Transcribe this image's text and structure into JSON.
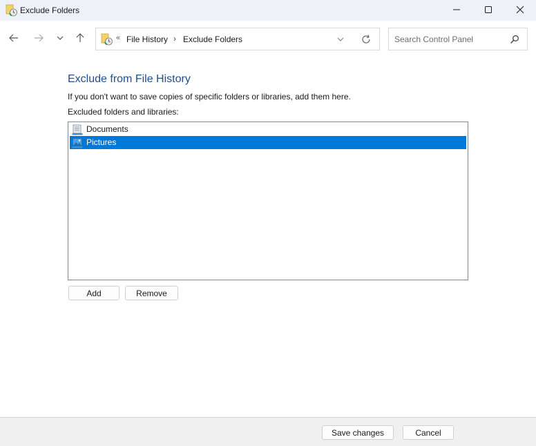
{
  "window": {
    "title": "Exclude Folders",
    "app_icon": "file-history-icon",
    "controls": {
      "minimize": "minimize-icon",
      "maximize": "maximize-icon",
      "close": "close-icon"
    }
  },
  "navigation": {
    "back_icon": "arrow-left-icon",
    "forward_icon": "arrow-right-icon",
    "recent_icon": "chevron-down-icon",
    "up_icon": "arrow-up-icon",
    "address": {
      "overflow_glyph": "«",
      "breadcrumbs": [
        "File History",
        "Exclude Folders"
      ],
      "separator": "›"
    },
    "search": {
      "placeholder": "Search Control Panel",
      "value": ""
    }
  },
  "main": {
    "heading": "Exclude from File History",
    "description": "If you don't want to save copies of specific folders or libraries, add them here.",
    "list_label": "Excluded folders and libraries:",
    "items": [
      {
        "label": "Documents",
        "icon": "documents-library-icon",
        "selected": false
      },
      {
        "label": "Pictures",
        "icon": "pictures-library-icon",
        "selected": true
      }
    ],
    "add_label": "Add",
    "remove_label": "Remove"
  },
  "footer": {
    "save_label": "Save changes",
    "cancel_label": "Cancel"
  },
  "colors": {
    "heading": "#1e4e8c",
    "selection": "#0078d7",
    "titlebar": "#eef2f8",
    "footer": "#f0f0f0"
  }
}
